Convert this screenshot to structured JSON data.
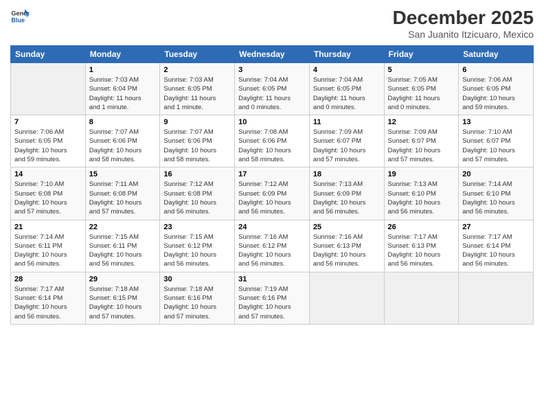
{
  "logo": {
    "line1": "General",
    "line2": "Blue"
  },
  "title": "December 2025",
  "subtitle": "San Juanito Itzicuaro, Mexico",
  "days_of_week": [
    "Sunday",
    "Monday",
    "Tuesday",
    "Wednesday",
    "Thursday",
    "Friday",
    "Saturday"
  ],
  "weeks": [
    [
      {
        "day": "",
        "detail": ""
      },
      {
        "day": "1",
        "detail": "Sunrise: 7:03 AM\nSunset: 6:04 PM\nDaylight: 11 hours\nand 1 minute."
      },
      {
        "day": "2",
        "detail": "Sunrise: 7:03 AM\nSunset: 6:05 PM\nDaylight: 11 hours\nand 1 minute."
      },
      {
        "day": "3",
        "detail": "Sunrise: 7:04 AM\nSunset: 6:05 PM\nDaylight: 11 hours\nand 0 minutes."
      },
      {
        "day": "4",
        "detail": "Sunrise: 7:04 AM\nSunset: 6:05 PM\nDaylight: 11 hours\nand 0 minutes."
      },
      {
        "day": "5",
        "detail": "Sunrise: 7:05 AM\nSunset: 6:05 PM\nDaylight: 11 hours\nand 0 minutes."
      },
      {
        "day": "6",
        "detail": "Sunrise: 7:06 AM\nSunset: 6:05 PM\nDaylight: 10 hours\nand 59 minutes."
      }
    ],
    [
      {
        "day": "7",
        "detail": "Sunrise: 7:06 AM\nSunset: 6:05 PM\nDaylight: 10 hours\nand 59 minutes."
      },
      {
        "day": "8",
        "detail": "Sunrise: 7:07 AM\nSunset: 6:06 PM\nDaylight: 10 hours\nand 58 minutes."
      },
      {
        "day": "9",
        "detail": "Sunrise: 7:07 AM\nSunset: 6:06 PM\nDaylight: 10 hours\nand 58 minutes."
      },
      {
        "day": "10",
        "detail": "Sunrise: 7:08 AM\nSunset: 6:06 PM\nDaylight: 10 hours\nand 58 minutes."
      },
      {
        "day": "11",
        "detail": "Sunrise: 7:09 AM\nSunset: 6:07 PM\nDaylight: 10 hours\nand 57 minutes."
      },
      {
        "day": "12",
        "detail": "Sunrise: 7:09 AM\nSunset: 6:07 PM\nDaylight: 10 hours\nand 57 minutes."
      },
      {
        "day": "13",
        "detail": "Sunrise: 7:10 AM\nSunset: 6:07 PM\nDaylight: 10 hours\nand 57 minutes."
      }
    ],
    [
      {
        "day": "14",
        "detail": "Sunrise: 7:10 AM\nSunset: 6:08 PM\nDaylight: 10 hours\nand 57 minutes."
      },
      {
        "day": "15",
        "detail": "Sunrise: 7:11 AM\nSunset: 6:08 PM\nDaylight: 10 hours\nand 57 minutes."
      },
      {
        "day": "16",
        "detail": "Sunrise: 7:12 AM\nSunset: 6:08 PM\nDaylight: 10 hours\nand 56 minutes."
      },
      {
        "day": "17",
        "detail": "Sunrise: 7:12 AM\nSunset: 6:09 PM\nDaylight: 10 hours\nand 56 minutes."
      },
      {
        "day": "18",
        "detail": "Sunrise: 7:13 AM\nSunset: 6:09 PM\nDaylight: 10 hours\nand 56 minutes."
      },
      {
        "day": "19",
        "detail": "Sunrise: 7:13 AM\nSunset: 6:10 PM\nDaylight: 10 hours\nand 56 minutes."
      },
      {
        "day": "20",
        "detail": "Sunrise: 7:14 AM\nSunset: 6:10 PM\nDaylight: 10 hours\nand 56 minutes."
      }
    ],
    [
      {
        "day": "21",
        "detail": "Sunrise: 7:14 AM\nSunset: 6:11 PM\nDaylight: 10 hours\nand 56 minutes."
      },
      {
        "day": "22",
        "detail": "Sunrise: 7:15 AM\nSunset: 6:11 PM\nDaylight: 10 hours\nand 56 minutes."
      },
      {
        "day": "23",
        "detail": "Sunrise: 7:15 AM\nSunset: 6:12 PM\nDaylight: 10 hours\nand 56 minutes."
      },
      {
        "day": "24",
        "detail": "Sunrise: 7:16 AM\nSunset: 6:12 PM\nDaylight: 10 hours\nand 56 minutes."
      },
      {
        "day": "25",
        "detail": "Sunrise: 7:16 AM\nSunset: 6:13 PM\nDaylight: 10 hours\nand 56 minutes."
      },
      {
        "day": "26",
        "detail": "Sunrise: 7:17 AM\nSunset: 6:13 PM\nDaylight: 10 hours\nand 56 minutes."
      },
      {
        "day": "27",
        "detail": "Sunrise: 7:17 AM\nSunset: 6:14 PM\nDaylight: 10 hours\nand 56 minutes."
      }
    ],
    [
      {
        "day": "28",
        "detail": "Sunrise: 7:17 AM\nSunset: 6:14 PM\nDaylight: 10 hours\nand 56 minutes."
      },
      {
        "day": "29",
        "detail": "Sunrise: 7:18 AM\nSunset: 6:15 PM\nDaylight: 10 hours\nand 57 minutes."
      },
      {
        "day": "30",
        "detail": "Sunrise: 7:18 AM\nSunset: 6:16 PM\nDaylight: 10 hours\nand 57 minutes."
      },
      {
        "day": "31",
        "detail": "Sunrise: 7:19 AM\nSunset: 6:16 PM\nDaylight: 10 hours\nand 57 minutes."
      },
      {
        "day": "",
        "detail": ""
      },
      {
        "day": "",
        "detail": ""
      },
      {
        "day": "",
        "detail": ""
      }
    ]
  ]
}
